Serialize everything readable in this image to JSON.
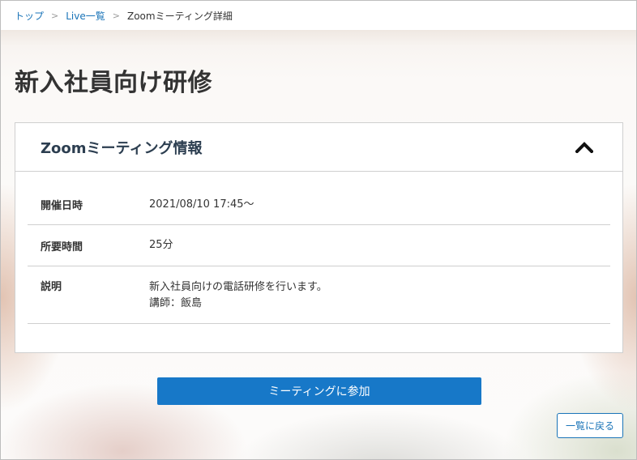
{
  "breadcrumb": {
    "items": [
      "トップ",
      "Live一覧"
    ],
    "separator": ">",
    "current": "Zoomミーティング詳細"
  },
  "page": {
    "title": "新入社員向け研修"
  },
  "panel": {
    "title": "Zoomミーティング情報",
    "toggle_icon": "chevron-up-icon",
    "rows": [
      {
        "label": "開催日時",
        "value": "2021/08/10 17:45～"
      },
      {
        "label": "所要時間",
        "value": "25分"
      },
      {
        "label": "説明",
        "value_lines": [
          "新入社員向けの電話研修を行います。",
          "講師：飯島"
        ]
      }
    ]
  },
  "actions": {
    "join_label": "ミーティングに参加",
    "back_label": "一覧に戻る"
  },
  "colors": {
    "link": "#1a74b8",
    "primary_button": "#1778c8",
    "panel_title": "#2c3e50"
  }
}
